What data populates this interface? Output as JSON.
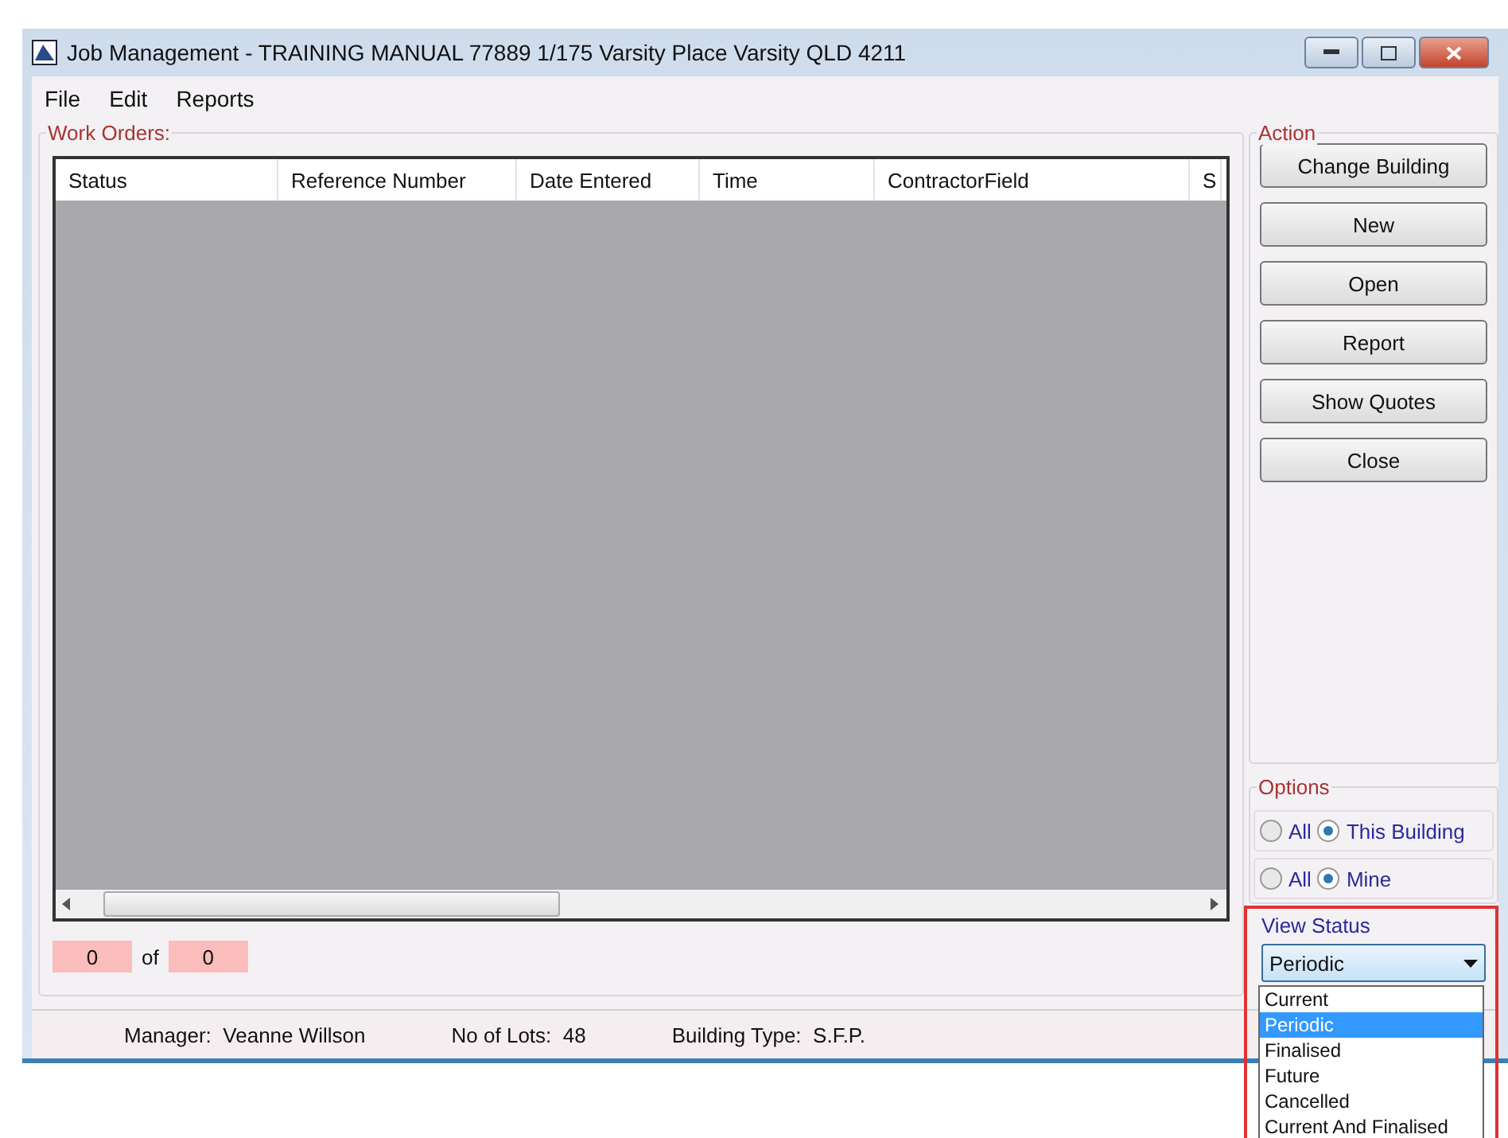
{
  "window": {
    "title": "Job Management - TRAINING MANUAL 77889 1/175 Varsity Place  Varsity QLD 4211"
  },
  "menu": [
    "File",
    "Edit",
    "Reports"
  ],
  "work_orders": {
    "legend": "Work Orders:",
    "columns": [
      "Status",
      "Reference Number",
      "Date Entered",
      "Time",
      "ContractorField",
      "S"
    ],
    "pager": {
      "current": "0",
      "of": "of",
      "total": "0"
    }
  },
  "action": {
    "legend": "Action",
    "buttons": [
      "Change Building",
      "New",
      "Open",
      "Report",
      "Show Quotes",
      "Close"
    ]
  },
  "options": {
    "legend": "Options",
    "groups": [
      {
        "items": [
          {
            "label": "All",
            "selected": false
          },
          {
            "label": "This Building",
            "selected": true
          }
        ]
      },
      {
        "items": [
          {
            "label": "All",
            "selected": false
          },
          {
            "label": "Mine",
            "selected": true
          }
        ]
      }
    ]
  },
  "view_status": {
    "label": "View Status",
    "value": "Periodic",
    "expanded": true,
    "highlighted": true,
    "options": [
      {
        "label": "Current",
        "selected": false
      },
      {
        "label": "Periodic",
        "selected": true
      },
      {
        "label": "Finalised",
        "selected": false
      },
      {
        "label": "Future",
        "selected": false
      },
      {
        "label": "Cancelled",
        "selected": false
      },
      {
        "label": "Current And Finalised",
        "selected": false
      }
    ]
  },
  "status_bar": [
    {
      "label": "Manager:",
      "value": "Veanne Willson"
    },
    {
      "label": "No of Lots:",
      "value": "48"
    },
    {
      "label": "Building Type:",
      "value": "S.F.P."
    }
  ]
}
